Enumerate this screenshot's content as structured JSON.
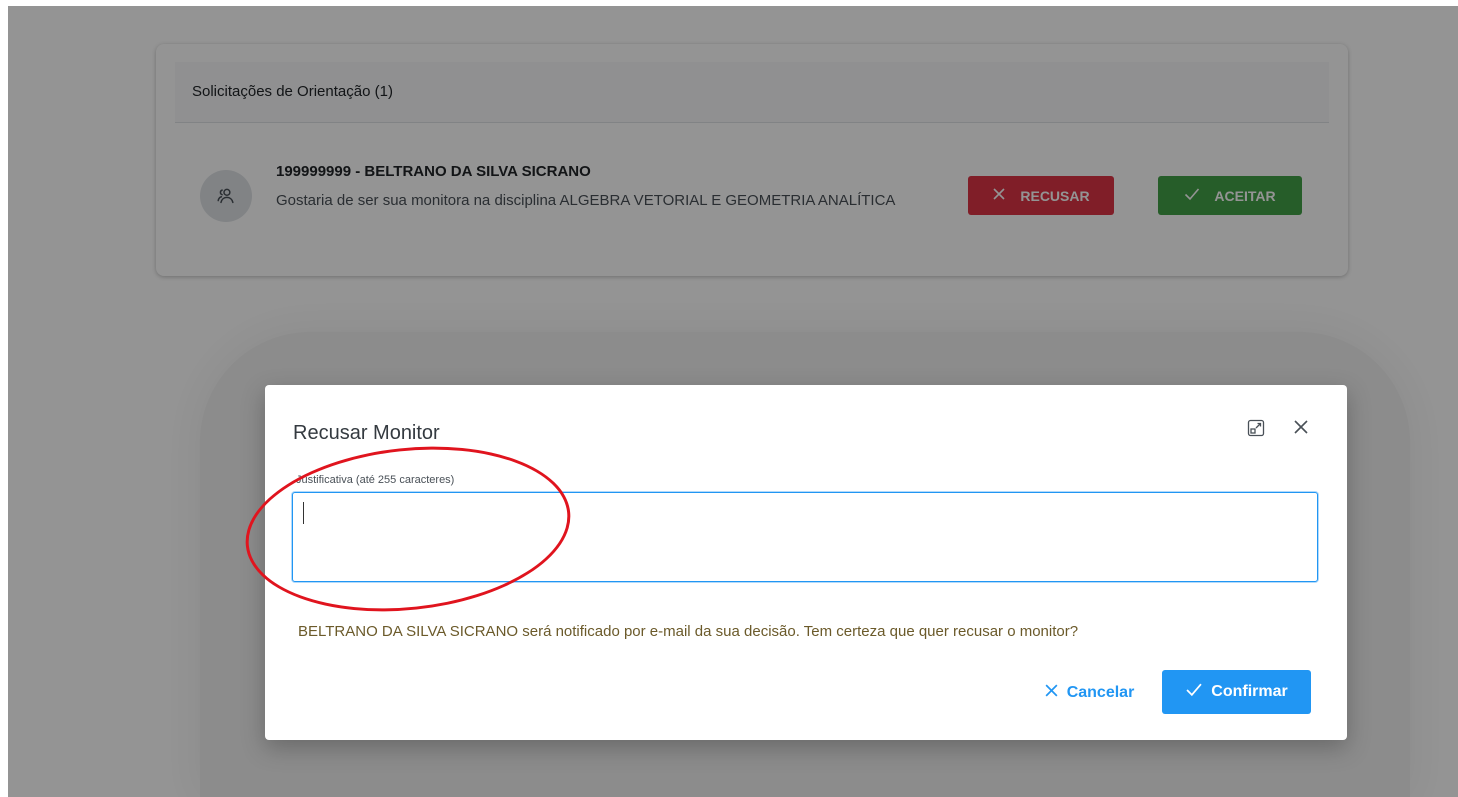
{
  "background_page": {
    "card_title": "Solicitações de Orientação (1)",
    "request": {
      "avatar_icon": "users-icon",
      "title": "199999999 - BELTRANO DA SILVA SICRANO",
      "message": "Gostaria de ser sua monitora na disciplina ALGEBRA VETORIAL E GEOMETRIA ANALÍTICA",
      "reject_label": "RECUSAR",
      "reject_icon": "x-icon",
      "accept_label": "ACEITAR",
      "accept_icon": "check-icon"
    }
  },
  "modal": {
    "title": "Recusar Monitor",
    "expand_icon": "maximize-icon",
    "close_icon": "close-icon",
    "field_label": "Justificativa (até 255 caracteres)",
    "field_value": "",
    "notice": "BELTRANO DA SILVA SICRANO será notificado por e-mail da sua decisão. Tem certeza que quer recusar o monitor?",
    "cancel_label": "Cancelar",
    "cancel_icon": "x-icon",
    "confirm_label": "Confirmar",
    "confirm_icon": "check-icon"
  },
  "colors": {
    "reject": "#dc3545",
    "accept": "#43a047",
    "primary": "#2196f3",
    "annotation": "#e0141e"
  }
}
